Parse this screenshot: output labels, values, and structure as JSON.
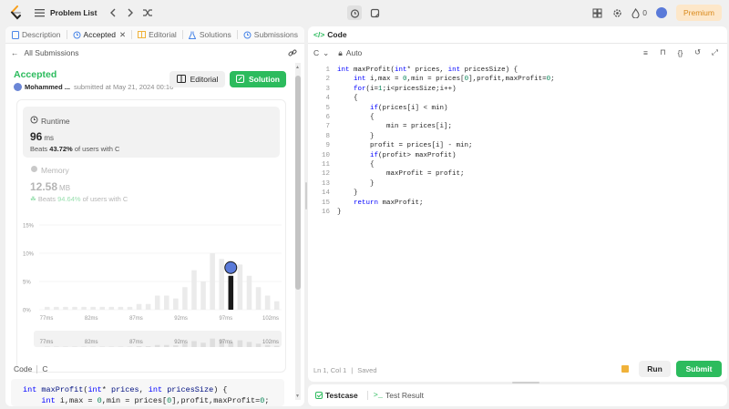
{
  "topbar": {
    "title": "Problem List",
    "fire_count": "0",
    "premium": "Premium"
  },
  "left_tabs": [
    {
      "label": "Description"
    },
    {
      "label": "Accepted"
    },
    {
      "label": "Editorial"
    },
    {
      "label": "Solutions"
    },
    {
      "label": "Submissions"
    }
  ],
  "submission": {
    "back_label": "All Submissions",
    "status": "Accepted",
    "user": "Mohammed ...",
    "submitted_text": "submitted at May 21, 2024 00:16",
    "editorial_btn": "Editorial",
    "solution_btn": "Solution"
  },
  "runtime": {
    "label": "Runtime",
    "value": "96",
    "unit": "ms",
    "beats_prefix": "Beats",
    "beats_pct": "43.72%",
    "beats_suffix": "of users with C"
  },
  "memory": {
    "label": "Memory",
    "value": "12.58",
    "unit": "MB",
    "beats_prefix": "Beats",
    "beats_pct": "94.64%",
    "beats_suffix": "of users with C"
  },
  "chart_data": {
    "type": "bar",
    "yticks": [
      "15%",
      "10%",
      "5%",
      "0%"
    ],
    "ylim": [
      0,
      15
    ],
    "xticks": [
      "77ms",
      "82ms",
      "87ms",
      "92ms",
      "97ms",
      "102ms"
    ],
    "values": [
      0.5,
      0.5,
      0.5,
      0.5,
      0.5,
      0.5,
      0.5,
      0.5,
      0.5,
      0.5,
      1,
      1,
      2.5,
      2.5,
      2,
      4,
      7,
      5,
      10,
      9,
      6,
      8,
      6,
      4,
      2.5,
      1.5
    ],
    "highlight_index": 20,
    "colors": {
      "bar": "#ebebeb",
      "highlight": "#1a1a1a",
      "text": "#9a9a9a"
    }
  },
  "code_section": {
    "label": "Code",
    "lang": "C",
    "preview_lines": [
      "int maxProfit(int* prices, int pricesSize) {",
      "    int i,max = 0,min = prices[0],profit,maxProfit=0;"
    ]
  },
  "editor": {
    "tab_label": "Code",
    "lang": "C",
    "mode": "Auto",
    "lines": [
      "int maxProfit(int* prices, int pricesSize) {",
      "    int i,max = 0,min = prices[0],profit,maxProfit=0;",
      "    for(i=1;i<pricesSize;i++)",
      "    {",
      "        if(prices[i] < min)",
      "        {",
      "            min = prices[i];",
      "        }",
      "        profit = prices[i] - min;",
      "        if(profit> maxProfit)",
      "        {",
      "            maxProfit = profit;",
      "        }",
      "    }",
      "    return maxProfit;",
      "}"
    ],
    "status": "Ln 1, Col 1",
    "saved": "Saved",
    "run": "Run",
    "submit": "Submit"
  },
  "bottom_tabs": [
    {
      "label": "Testcase"
    },
    {
      "label": "Test Result"
    }
  ]
}
